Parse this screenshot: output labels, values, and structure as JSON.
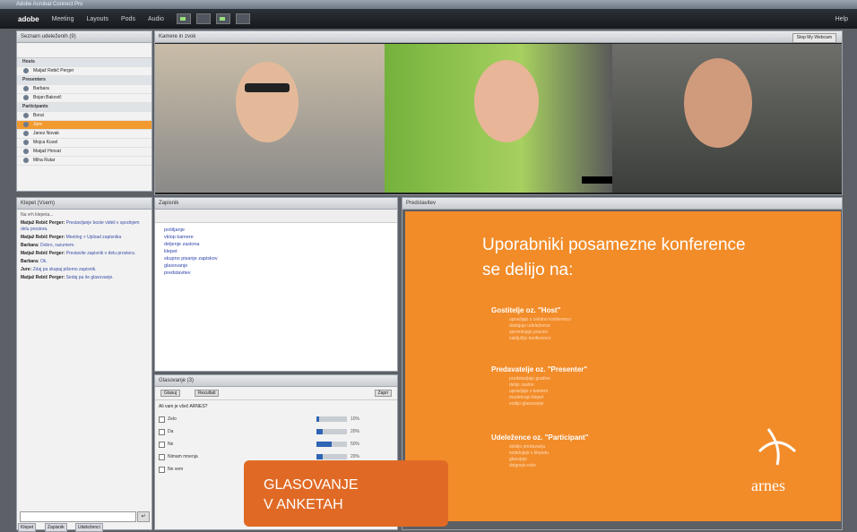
{
  "app": {
    "window_title": "Adobe Acrobat Connect Pro",
    "logo": "adobe",
    "menu": [
      "Meeting",
      "Layouts",
      "Pods",
      "Audio"
    ],
    "help": "Help"
  },
  "users_panel": {
    "title": "Seznam udeleženih (9)",
    "groups": [
      {
        "label": "Hosts",
        "users": [
          "Matjaž Rebič Perger"
        ]
      },
      {
        "label": "Presenters",
        "users": [
          "Barbara",
          "Bojan Bakovič"
        ]
      },
      {
        "label": "Participants",
        "users": [
          "Borut",
          "Jure",
          "Janez Novak",
          "Mojca Kozel",
          "Matjaž Hrovat",
          "Miha Rutar"
        ]
      }
    ],
    "selected_user": "Jure"
  },
  "chat_panel": {
    "title": "Klepet (Vsem)",
    "messages": [
      {
        "name": "",
        "text": "Na vrh klepeta..."
      },
      {
        "name": "Matjaž Rebič Perger:",
        "text": "Prestavljanje boste videli v spodnjem delu prostora."
      },
      {
        "name": "Matjaž Rebič Perger:",
        "text": "Meeting > Upload zapisnika"
      },
      {
        "name": "Barbara:",
        "text": "Dobro, razumem."
      },
      {
        "name": "Matjaž Rebič Perger:",
        "text": "Prestavite zapisnik v delu prostora."
      },
      {
        "name": "Barbara:",
        "text": "Ok."
      },
      {
        "name": "Jure:",
        "text": "Zdaj pa skupaj pišemo zapisnik."
      },
      {
        "name": "Matjaž Rebič Perger:",
        "text": "Sedaj pa še glasovanje."
      }
    ]
  },
  "video_panel": {
    "title": "Kamere in zvok",
    "button": "Stop My Webcam",
    "name_overlay": "Matjaž"
  },
  "notes_panel": {
    "title": "Zapisnik",
    "items": [
      "pošiljanje",
      "vklop kamere",
      "deljenje zaslona",
      "klepet",
      "skupno pisanje zapiskov",
      "glasovanje",
      "predstavitev"
    ]
  },
  "poll_panel": {
    "title": "Glasovanje (3)",
    "question": "Ali vam je všeč ARNES?",
    "options": [
      {
        "label": "Zelo",
        "percent": 10,
        "text": "10%"
      },
      {
        "label": "Da",
        "percent": 20,
        "text": "20%"
      },
      {
        "label": "Ne",
        "percent": 50,
        "text": "50%"
      },
      {
        "label": "Nimam mnenja",
        "percent": 20,
        "text": "20%"
      },
      {
        "label": "Ne vem",
        "percent": 0,
        "text": "0%"
      }
    ],
    "buttons": [
      "Glasuj",
      "Rezultati",
      "Zapri"
    ]
  },
  "slide_panel": {
    "title": "Predstavitev",
    "heading": "Uporabniki posamezne konference se delijo na:",
    "sections": [
      {
        "title": "Gostitelje oz. \"Host\"",
        "lines": [
          "upravljajo s celotno konferenco",
          "dodajajo udeležence",
          "spreminjajo pravice",
          "zaključijo konferenco"
        ]
      },
      {
        "title": "Predavatelje oz. \"Presenter\"",
        "lines": [
          "predstavljajo gradivo",
          "delijo zaslon",
          "upravljajo s kamero",
          "moderirajo klepet",
          "vodijo glasovanje"
        ]
      },
      {
        "title": "Udeležence oz. \"Participant\"",
        "lines": [
          "sledijo predavanju",
          "sodelujejo v klepetu",
          "glasujejo",
          "dvignejo roko"
        ]
      }
    ],
    "logo_text": "arnes"
  },
  "bottom_tabs": [
    "Klepet",
    "Zapisnik",
    "Udeleženci"
  ],
  "callout": {
    "line1": "GLASOVANJE",
    "line2": "V ANKETAH"
  },
  "colors": {
    "accent": "#f28c29",
    "callout": "#e06a25"
  }
}
